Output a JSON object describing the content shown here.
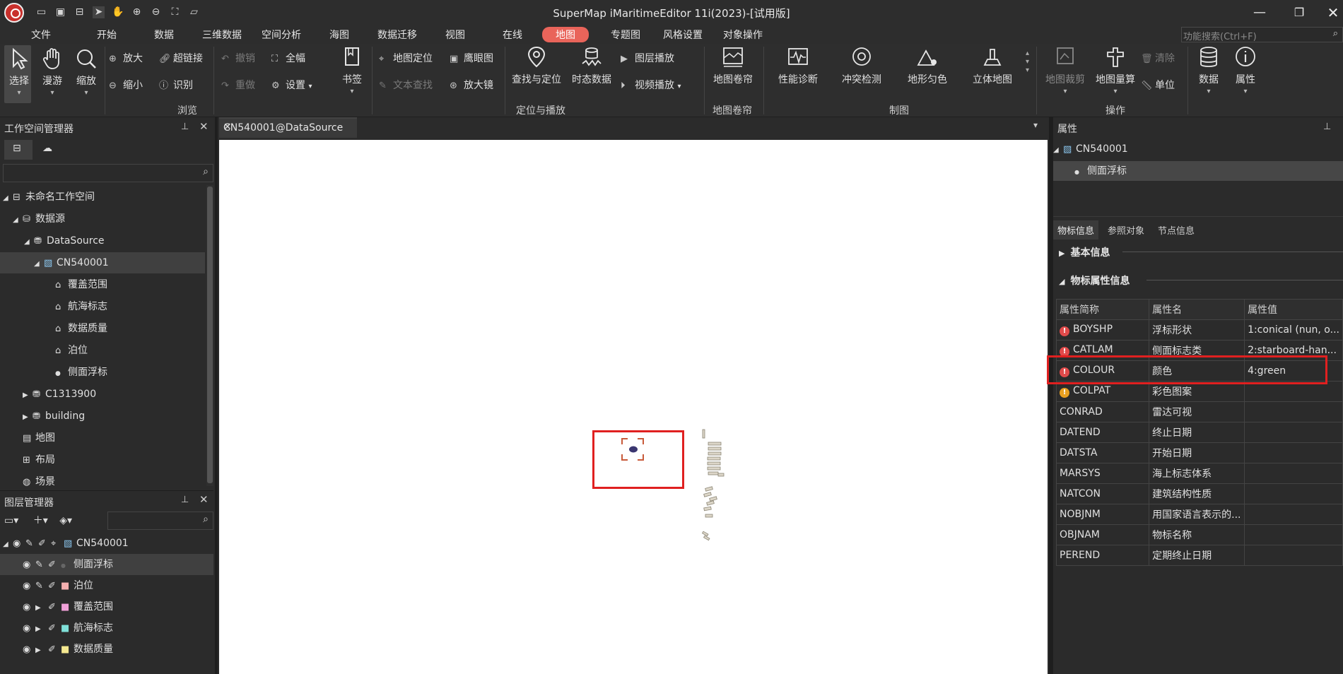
{
  "window": {
    "title": "SuperMap iMaritimeEditor 11i(2023)-[试用版]"
  },
  "menu": {
    "items": [
      "文件",
      "开始",
      "数据",
      "三维数据",
      "空间分析",
      "海图",
      "数据迁移",
      "视图",
      "在线",
      "地图",
      "专题图",
      "风格设置",
      "对象操作"
    ],
    "active_index": 9,
    "search_placeholder": "功能搜索(Ctrl+F)"
  },
  "ribbon": {
    "browse": {
      "select": "选择",
      "pan": "漫游",
      "zoom": "缩放",
      "zoom_in": "放大",
      "zoom_out": "缩小",
      "hyperlink": "超链接",
      "identify": "识别",
      "undo": "撤销",
      "redo": "重做",
      "full_extent": "全幅",
      "settings": "设置",
      "bookmark": "书签",
      "group": "浏览"
    },
    "locate": {
      "map_locate": "地图定位",
      "text_search": "文本查找",
      "eagle_eye": "鹰眼图",
      "magnifier": "放大镜",
      "find_locate": "查找与定位",
      "temporal": "时态数据",
      "layer_play": "图层播放",
      "video_play": "视频播放",
      "group": "定位与播放"
    },
    "scroll": {
      "label": "地图卷帘",
      "group": "地图卷帘"
    },
    "mapping": {
      "perf": "性能诊断",
      "conflict": "冲突检测",
      "terrain": "地形匀色",
      "stereo": "立体地图",
      "group": "制图"
    },
    "ops": {
      "clip": "地图裁剪",
      "measure": "地图量算",
      "clear": "清除",
      "unit": "单位",
      "group": "操作"
    },
    "data": "数据",
    "attributes": "属性"
  },
  "workspace": {
    "title": "工作空间管理器",
    "tree": [
      {
        "label": "未命名工作空间"
      },
      {
        "label": "数据源"
      },
      {
        "label": "DataSource"
      },
      {
        "label": "CN540001"
      },
      {
        "label": "覆盖范围"
      },
      {
        "label": "航海标志"
      },
      {
        "label": "数据质量"
      },
      {
        "label": "泊位"
      },
      {
        "label": "侧面浮标"
      },
      {
        "label": "C1313900"
      },
      {
        "label": "building"
      },
      {
        "label": "地图"
      },
      {
        "label": "布局"
      },
      {
        "label": "场景"
      }
    ]
  },
  "layers": {
    "title": "图层管理器",
    "items": [
      {
        "label": "CN540001"
      },
      {
        "label": "侧面浮标"
      },
      {
        "label": "泊位"
      },
      {
        "label": "覆盖范围"
      },
      {
        "label": "航海标志"
      },
      {
        "label": "数据质量"
      }
    ],
    "colors": {
      "泊位": "#f4b0b0",
      "覆盖范围": "#f0a0d8",
      "航海标志": "#7fe0d8",
      "数据质量": "#f4e890"
    }
  },
  "map_tab": {
    "label": "CN540001@DataSource"
  },
  "properties": {
    "title": "属性",
    "root": "CN540001",
    "child": "侧面浮标",
    "tabs": [
      "物标信息",
      "参照对象",
      "节点信息"
    ],
    "sections": {
      "basic": "基本信息",
      "attr": "物标属性信息"
    },
    "columns": [
      "属性简称",
      "属性名",
      "属性值"
    ],
    "rows": [
      {
        "code": "BOYSHP",
        "name": "浮标形状",
        "value": "1:conical (nun, o...",
        "flag": "red"
      },
      {
        "code": "CATLAM",
        "name": "侧面标志类",
        "value": "2:starboard-han...",
        "flag": "red"
      },
      {
        "code": "COLOUR",
        "name": "颜色",
        "value": "4:green",
        "flag": "red"
      },
      {
        "code": "COLPAT",
        "name": "彩色图案",
        "value": "",
        "flag": "orange"
      },
      {
        "code": "CONRAD",
        "name": "雷达可视",
        "value": "",
        "flag": ""
      },
      {
        "code": "DATEND",
        "name": "终止日期",
        "value": "",
        "flag": ""
      },
      {
        "code": "DATSTA",
        "name": "开始日期",
        "value": "",
        "flag": ""
      },
      {
        "code": "MARSYS",
        "name": "海上标志体系",
        "value": "",
        "flag": ""
      },
      {
        "code": "NATCON",
        "name": "建筑结构性质",
        "value": "",
        "flag": ""
      },
      {
        "code": "NOBJNM",
        "name": "用国家语言表示的...",
        "value": "",
        "flag": ""
      },
      {
        "code": "OBJNAM",
        "name": "物标名称",
        "value": "",
        "flag": ""
      },
      {
        "code": "PEREND",
        "name": "定期终止日期",
        "value": "",
        "flag": ""
      }
    ]
  }
}
